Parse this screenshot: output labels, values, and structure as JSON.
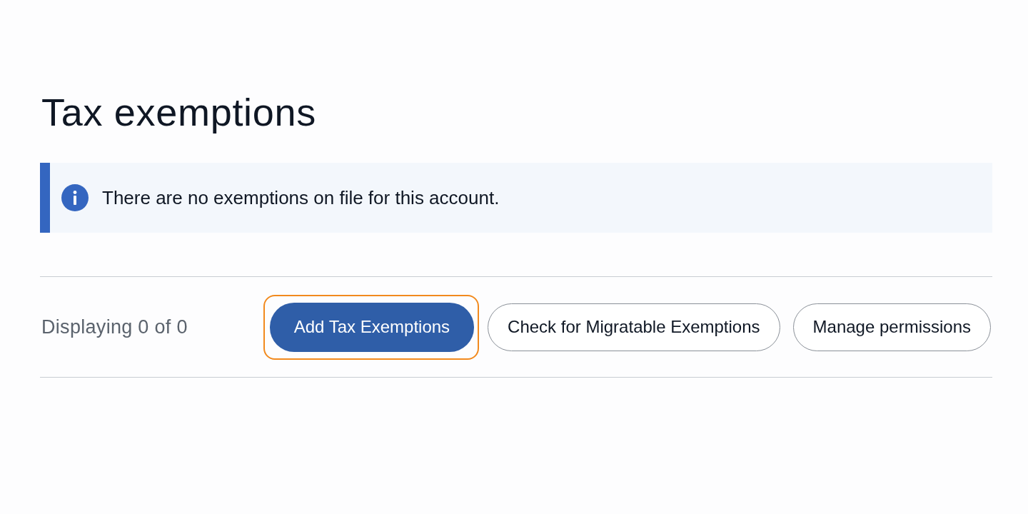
{
  "page": {
    "title": "Tax exemptions"
  },
  "alert": {
    "kind": "info",
    "message": "There are no exemptions on file for this account."
  },
  "toolbar": {
    "count_text": "Displaying 0 of 0",
    "buttons": [
      {
        "label": "Add Tax Exemptions",
        "kind": "primary",
        "focused": true
      },
      {
        "label": "Check for Migratable Exemptions",
        "kind": "secondary",
        "focused": false
      },
      {
        "label": "Manage permissions",
        "kind": "secondary",
        "focused": false
      }
    ]
  }
}
